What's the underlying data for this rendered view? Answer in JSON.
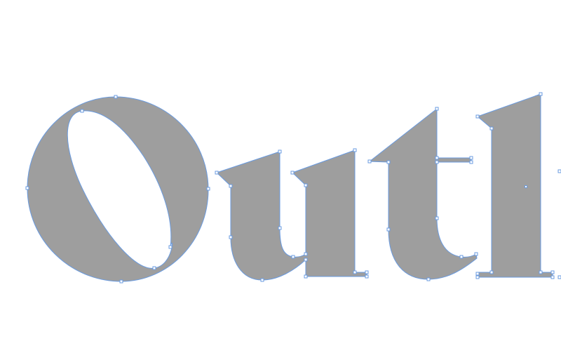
{
  "canvas": {
    "background": "#ffffff",
    "fill_color": "#9e9e9e",
    "outline_color": "#6a9be0",
    "anchor_fill": "#ffffff"
  },
  "artwork": {
    "text": "Outl",
    "selected": true,
    "glyphs": [
      {
        "char": "O",
        "name": "glyph-O"
      },
      {
        "char": "u",
        "name": "glyph-u"
      },
      {
        "char": "t",
        "name": "glyph-t"
      },
      {
        "char": "l",
        "name": "glyph-l"
      }
    ]
  }
}
